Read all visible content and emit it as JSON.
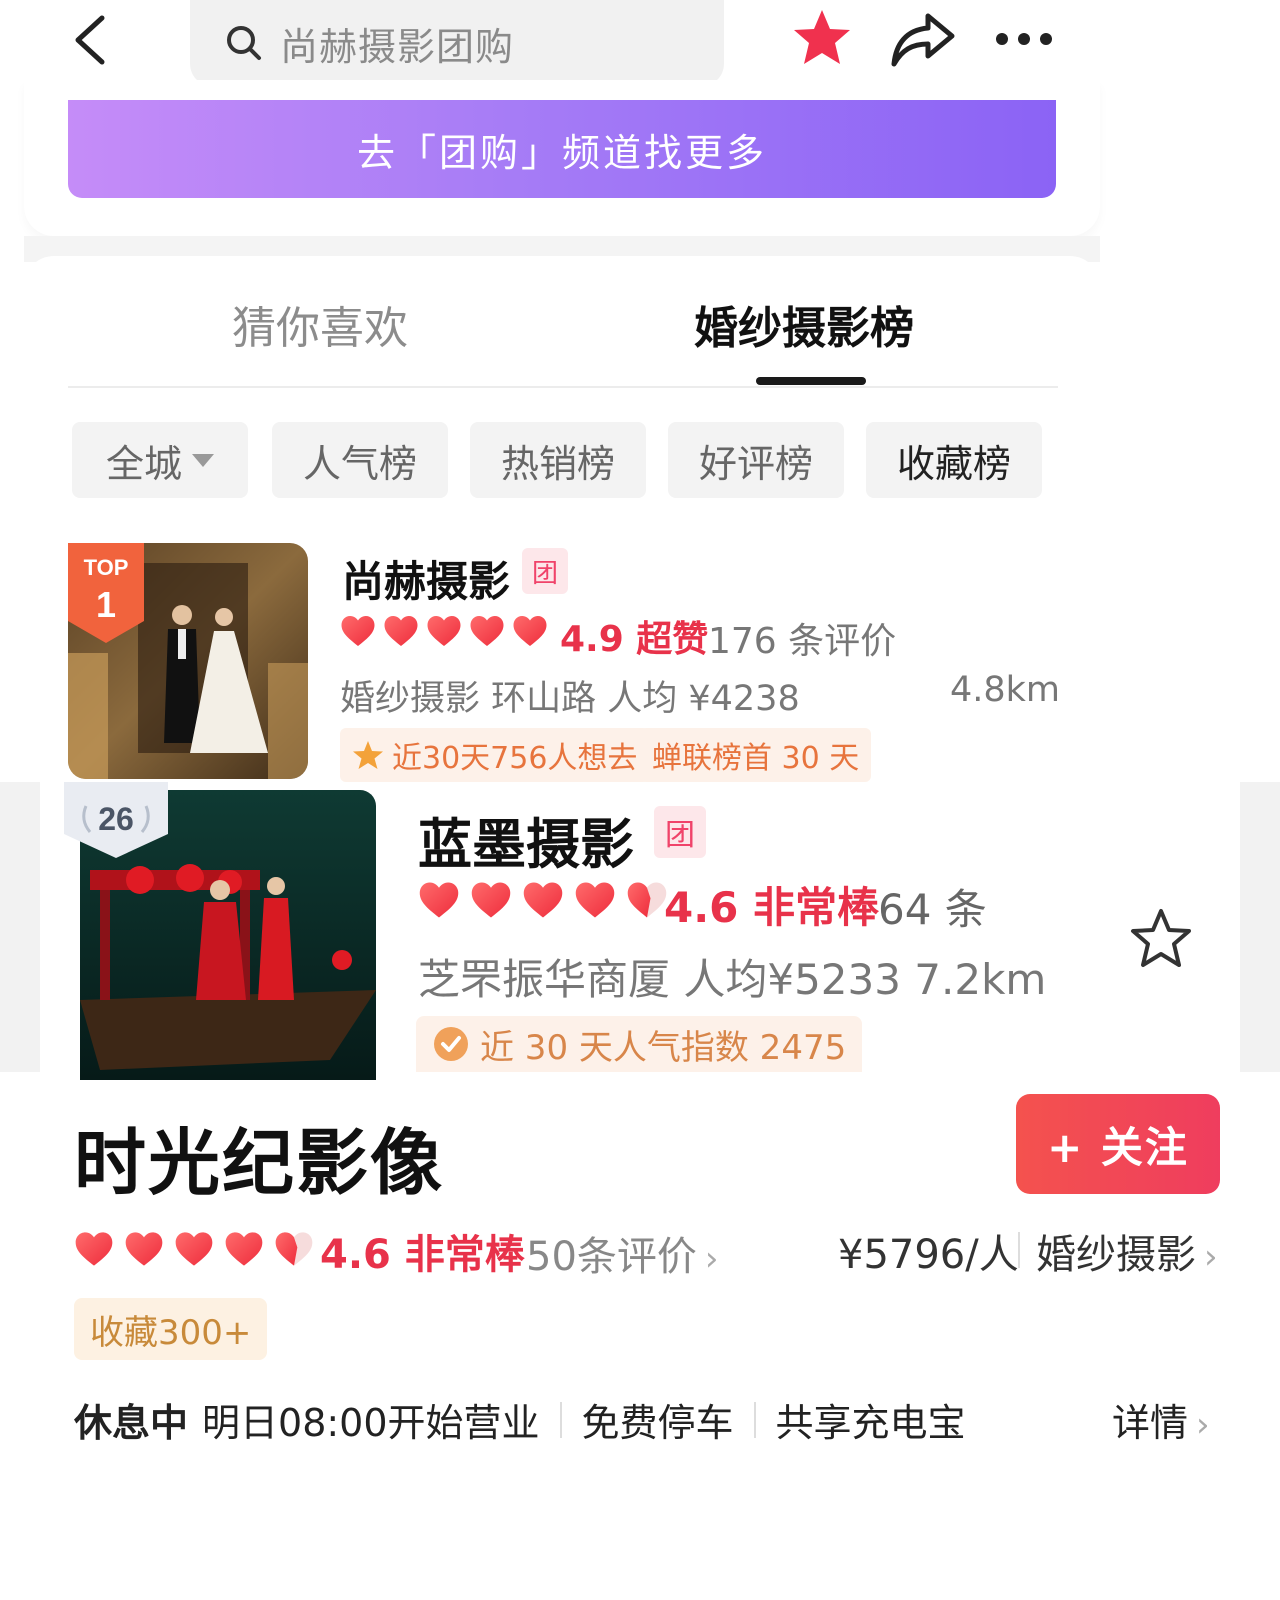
{
  "header": {
    "search_text": "尚赫摄影团购",
    "icons": [
      "back-icon",
      "search-icon",
      "star-icon",
      "share-icon",
      "more-icon"
    ],
    "favorited": true
  },
  "promo_banner": {
    "label": "去「团购」频道找更多"
  },
  "tabs": [
    {
      "label": "猜你喜欢",
      "active": false
    },
    {
      "label": "婚纱摄影榜",
      "active": true
    }
  ],
  "filters": [
    {
      "label": "全城",
      "dropdown": true
    },
    {
      "label": "人气榜"
    },
    {
      "label": "热销榜"
    },
    {
      "label": "好评榜"
    },
    {
      "label": "收藏榜",
      "selected": true
    }
  ],
  "listings": [
    {
      "badge_top": "TOP",
      "badge_rank": "1",
      "name": "尚赫摄影",
      "tuan": "团",
      "hearts": 5,
      "rating": "4.9 超赞",
      "reviews": "176 条评价",
      "meta": "婚纱摄影   环山路   人均 ¥4238",
      "distance": "4.8km",
      "tags": [
        "近30天756人想去",
        "蝉联榜首 30 天"
      ]
    },
    {
      "badge_rank": "26",
      "name": "蓝墨摄影",
      "tuan": "团",
      "hearts": 4.5,
      "rating": "4.6 非常棒",
      "reviews": "64 条",
      "meta": "芝罘振华商厦  人均¥5233  7.2km",
      "tags": [
        "近 30 天人气指数 2475"
      ]
    }
  ],
  "shop": {
    "title": "时光纪影像",
    "follow_label": "+ 关注",
    "hearts": 4.5,
    "rating": "4.6 非常棒",
    "reviews": "50条评价",
    "price": "¥5796/人",
    "category": "婚纱摄影",
    "favorites": "收藏300+",
    "status": "休息中",
    "hours": "明日08:00开始营业",
    "amenities": [
      "免费停车",
      "共享充电宝"
    ],
    "detail_label": "详情"
  },
  "colors": {
    "accent_red": "#e8324a",
    "banner_start": "#c58cf8",
    "banner_end": "#8b63f5",
    "follow_button": "#f4524e"
  }
}
